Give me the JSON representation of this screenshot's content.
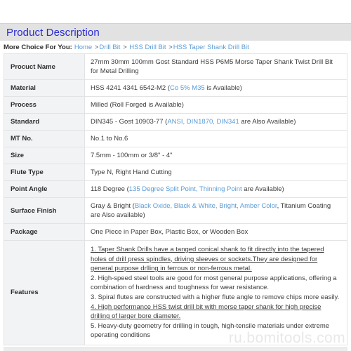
{
  "header": {
    "title": "Product Description"
  },
  "breadcrumb": {
    "lead": "More Choice For You:",
    "items": [
      {
        "label": "Home",
        "sep": ">"
      },
      {
        "label": "Drill Bit",
        "sep": "> "
      },
      {
        "label": "HSS Drill Bit",
        "sep": ">"
      },
      {
        "label": "HSS Taper Shank Drill Bit",
        "sep": ""
      }
    ]
  },
  "spec_table": {
    "rows": [
      {
        "key": "Procuct Name",
        "parts": [
          {
            "text": "27mm 30mm 100mm Gost Standard HSS P6M5 Morse Taper Shank Twist Drill Bit for Metal Drilling",
            "style": "plain"
          }
        ]
      },
      {
        "key": "Material",
        "parts": [
          {
            "text": "HSS 4241 4341 6542-M2 (",
            "style": "plain"
          },
          {
            "text": "Co 5% M35",
            "style": "opt"
          },
          {
            "text": " is Available)",
            "style": "plain"
          }
        ]
      },
      {
        "key": "Process",
        "parts": [
          {
            "text": "Milled (Roll Forged is Available)",
            "style": "plain"
          }
        ]
      },
      {
        "key": "Standard",
        "parts": [
          {
            "text": "DIN345 - Gost 10903-77  (",
            "style": "plain"
          },
          {
            "text": "ANSI, DIN1870, DIN341",
            "style": "opt"
          },
          {
            "text": " are Also Available)",
            "style": "plain"
          }
        ]
      },
      {
        "key": "MT No.",
        "parts": [
          {
            "text": "No.1 to No.6",
            "style": "plain"
          }
        ]
      },
      {
        "key": "Size",
        "parts": [
          {
            "text": "7.5mm - 100mm or 3/8\" - 4\"",
            "style": "plain"
          }
        ]
      },
      {
        "key": "Flute Type",
        "parts": [
          {
            "text": "Type N, Right Hand Cutting",
            "style": "plain"
          }
        ]
      },
      {
        "key": "Point Angle",
        "parts": [
          {
            "text": "118 Degree (",
            "style": "plain"
          },
          {
            "text": "135 Degree Split Point, Thinning Point",
            "style": "opt"
          },
          {
            "text": " are Available)",
            "style": "plain"
          }
        ]
      },
      {
        "key": "Surface Finish",
        "parts": [
          {
            "text": "Gray & Bright (",
            "style": "plain"
          },
          {
            "text": "Black Oxide, Black & White, Bright, Amber Color",
            "style": "opt"
          },
          {
            "text": ", Titanium Coating are Also available)",
            "style": "plain"
          }
        ]
      },
      {
        "key": "Package",
        "parts": [
          {
            "text": "One Piece in Paper Box, Plastic Box, or Wooden Box",
            "style": "plain"
          }
        ]
      }
    ],
    "features": {
      "key": "Features",
      "items": [
        {
          "text": "1. Taper Shank Drills have a tanged conical shank to fit directly into the tapered holes of drill press spindles, driving sleeves or sockets.They are designed for general purpose drlling in ferrous or non-ferrous metal.",
          "underline": true
        },
        {
          "text": "2. High-speed steel tools are good for most general purpose applications, offering a combination of hardness and toughness for wear resistance.",
          "underline": false
        },
        {
          "text": "3. Spiral flutes are constructed with a higher flute angle to remove chips more easily.",
          "underline": false
        },
        {
          "text": "4. High performance HSS twist drill bit with morse taper shank for high precise drilling of larger bore diameter.",
          "underline": true
        },
        {
          "text": "5. Heavy-duty geometry for drilling in tough, high-tensile materials under extreme operating conditions",
          "underline": false
        }
      ]
    }
  },
  "footer": {
    "watermark": "ru.bomitools.com"
  },
  "colors": {
    "header_band": "#e2e2e2",
    "title_blue": "#2b2bd6",
    "link_blue": "#5b9bd5",
    "key_cell_bg": "#f2f3f5",
    "watermark": "#e8e8e8"
  }
}
